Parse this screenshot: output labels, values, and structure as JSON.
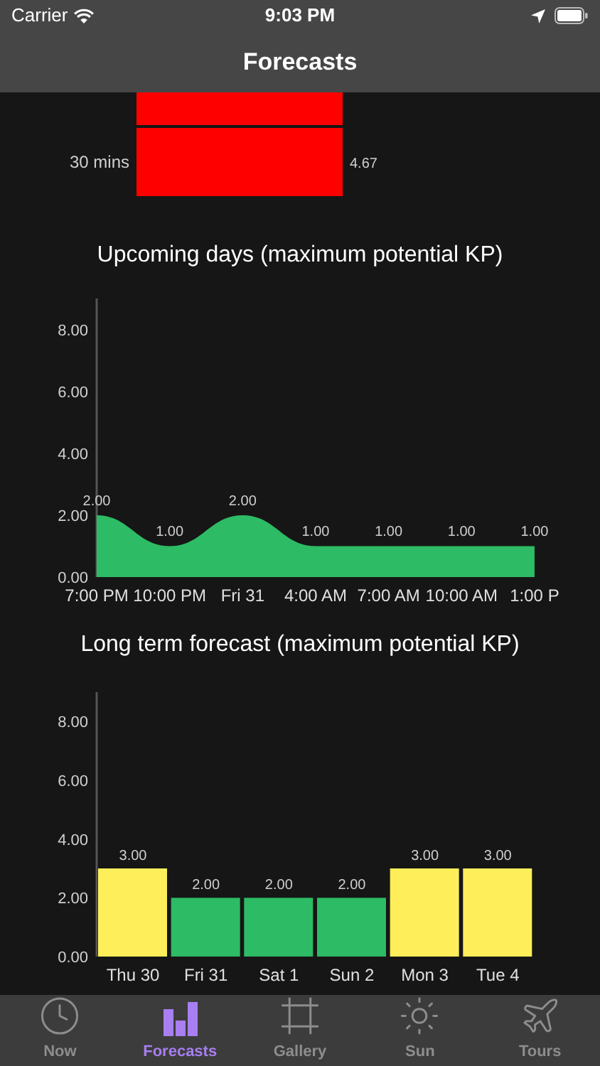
{
  "status_bar": {
    "carrier": "Carrier",
    "time": "9:03 PM"
  },
  "nav": {
    "title": "Forecasts"
  },
  "short_term": {
    "clipped_bar": true,
    "rows": [
      {
        "label": "30 mins",
        "value": "4.67",
        "color": "#ff0000"
      }
    ]
  },
  "upcoming": {
    "title": "Upcoming days (maximum potential KP)",
    "chart_data": {
      "type": "area",
      "categories": [
        "7:00 PM",
        "10:00 PM",
        "Fri 31",
        "4:00 AM",
        "7:00 AM",
        "10:00 AM",
        "1:00 P"
      ],
      "series": [
        {
          "color": "#2dbb65",
          "values": [
            2,
            1,
            2,
            1,
            1,
            1,
            1
          ]
        }
      ],
      "value_labels": [
        "2.00",
        "1.00",
        "2.00",
        "1.00",
        "1.00",
        "1.00",
        "1.00"
      ],
      "ylim": [
        0,
        9
      ],
      "yticks": [
        {
          "value": 0,
          "label": "0.00"
        },
        {
          "value": 2,
          "label": "2.00"
        },
        {
          "value": 4,
          "label": "4.00"
        },
        {
          "value": 6,
          "label": "6.00"
        },
        {
          "value": 8,
          "label": "8.00"
        }
      ]
    }
  },
  "long_term": {
    "title": "Long term forecast (maximum potential KP)",
    "chart_data": {
      "type": "bar",
      "categories": [
        "Thu 30",
        "Fri 31",
        "Sat 1",
        "Sun 2",
        "Mon 3",
        "Tue 4"
      ],
      "series": [
        {
          "values": [
            3,
            2,
            2,
            2,
            3,
            3
          ]
        }
      ],
      "colors": [
        "#fdee5a",
        "#2dbb65",
        "#2dbb65",
        "#2dbb65",
        "#fdee5a",
        "#fdee5a"
      ],
      "value_labels": [
        "3.00",
        "2.00",
        "2.00",
        "2.00",
        "3.00",
        "3.00"
      ],
      "ylim": [
        0,
        9
      ],
      "yticks": [
        {
          "value": 0,
          "label": "0.00"
        },
        {
          "value": 2,
          "label": "2.00"
        },
        {
          "value": 4,
          "label": "4.00"
        },
        {
          "value": 6,
          "label": "6.00"
        },
        {
          "value": 8,
          "label": "8.00"
        }
      ]
    }
  },
  "tabs": [
    {
      "label": "Now",
      "kind": "clock",
      "selected": false
    },
    {
      "label": "Forecasts",
      "kind": "chart",
      "selected": true
    },
    {
      "label": "Gallery",
      "kind": "frame",
      "selected": false
    },
    {
      "label": "Sun",
      "kind": "sun",
      "selected": false
    },
    {
      "label": "Tours",
      "kind": "plane",
      "selected": false
    }
  ]
}
